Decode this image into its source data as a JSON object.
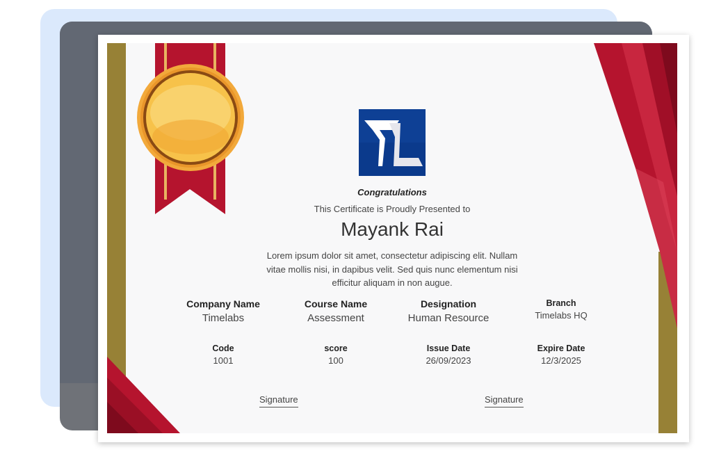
{
  "certificate": {
    "congrats": "Congratulations",
    "presented": "This Certificate is Proudly Presented to",
    "recipient": "Mayank Rai",
    "description": "Lorem ipsum dolor sit amet, consectetur adipiscing elit. Nullam vitae mollis nisi, in dapibus velit. Sed quis nunc elementum nisi efficitur aliquam in non augue.",
    "fields": {
      "company": {
        "label": "Company Name",
        "value": "Timelabs"
      },
      "course": {
        "label": "Course Name",
        "value": "Assessment"
      },
      "designation": {
        "label": "Designation",
        "value": "Human Resource"
      },
      "branch": {
        "label": "Branch",
        "value": "Timelabs HQ"
      },
      "code": {
        "label": "Code",
        "value": "1001"
      },
      "score": {
        "label": "score",
        "value": "100"
      },
      "issue_date": {
        "label": "Issue Date",
        "value": "26/09/2023"
      },
      "expire_date": {
        "label": "Expire Date",
        "value": "12/3/2025"
      }
    },
    "signatures": {
      "left": "Signature",
      "right": "Signature"
    }
  },
  "colors": {
    "gold": "#978136",
    "crimson": "#b5142e",
    "logo_blue": "#0b3a8c",
    "backdrop_blue": "#dbe9fc",
    "backdrop_gray": "#6f7278"
  },
  "icons": {
    "medal": "gold-medal-icon",
    "logo": "timelabs-logo"
  }
}
